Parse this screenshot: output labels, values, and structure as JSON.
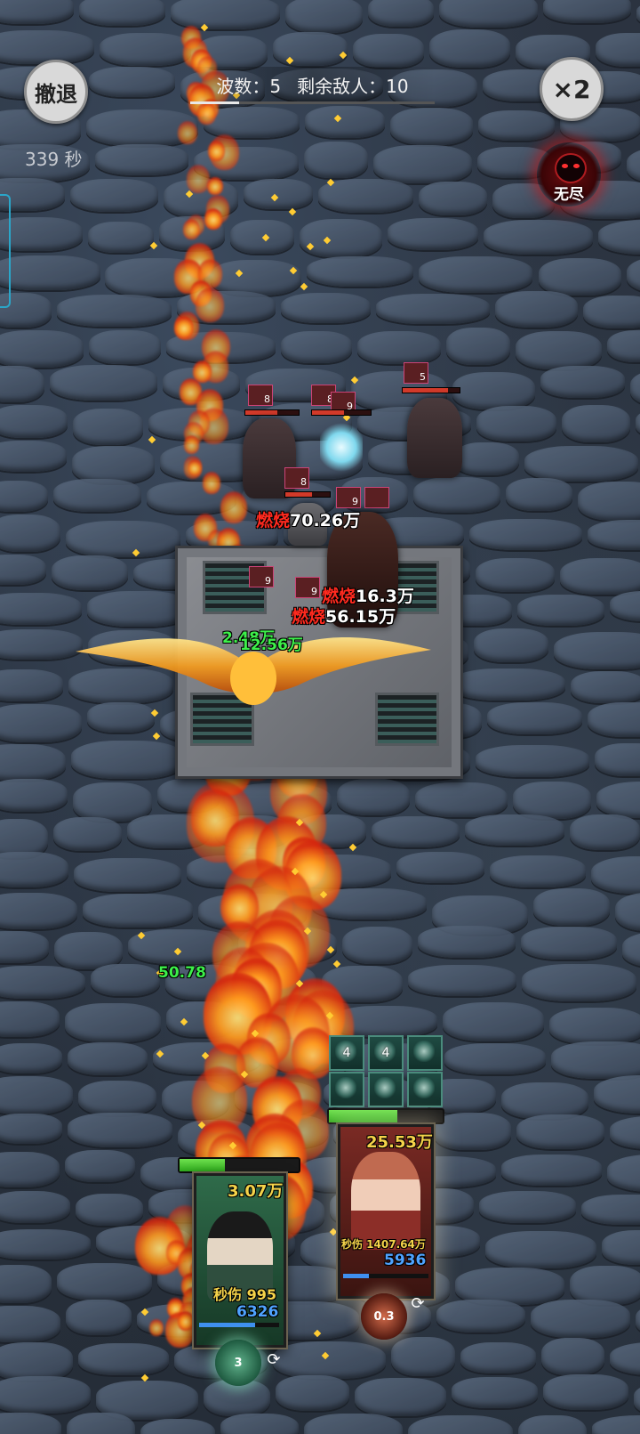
{
  "hud": {
    "retreat_label": "撤退",
    "timer": "339 秒",
    "wave_label": "波数：",
    "wave_value": "5",
    "enemies_label": "剩余敌人：",
    "enemies_value": "10",
    "wave_progress": 0.2,
    "speed_label": "×2",
    "endless_label": "无尽"
  },
  "enemies": [
    {
      "level": "8",
      "hp": 0.6
    },
    {
      "level": "8",
      "hp": 0.55
    },
    {
      "level": "9",
      "hp": 0.7
    },
    {
      "level": "5",
      "hp": 0.8
    },
    {
      "level": "8",
      "hp": 0.6
    },
    {
      "level": "9",
      "hp": 0.5
    },
    {
      "level": "9",
      "hp": 0.5
    },
    {
      "level": "9",
      "hp": 0.4
    }
  ],
  "damage_numbers": [
    {
      "tag": "燃烧",
      "value": "70.26万"
    },
    {
      "tag": "燃烧",
      "value": "16.3万"
    },
    {
      "tag": "燃烧",
      "value": "56.15万"
    },
    {
      "tag": "",
      "value": "2.48万"
    },
    {
      "tag": "",
      "value": "12.56万"
    },
    {
      "tag": "",
      "value": "50.78"
    }
  ],
  "skills": [
    {
      "icon": "bow-skill-icon",
      "count": "4"
    },
    {
      "icon": "wind-skill-icon",
      "count": "4"
    },
    {
      "icon": "dragon-skill-icon",
      "count": ""
    },
    {
      "icon": "figure-skill-icon",
      "count": ""
    },
    {
      "icon": "tree-skill-icon",
      "count": ""
    },
    {
      "icon": "spirit-skill-icon",
      "count": ""
    }
  ],
  "heroes": [
    {
      "name": "green-hero",
      "attack": "3.07万",
      "dps_label": "秒伤 995",
      "mana": "6326",
      "hp": 0.38,
      "mana_fill": 0.7,
      "ult_value": "3",
      "accent": "#2f6b4a"
    },
    {
      "name": "red-hero",
      "attack": "25.53万",
      "dps_label": "秒伤 1407.64万",
      "mana": "5936",
      "hp": 0.6,
      "mana_fill": 0.3,
      "ult_value": "0.3",
      "accent": "#7a2a24"
    }
  ],
  "colors": {
    "burn_tag": "#ff2a1f",
    "hero_hp": "#4bd336",
    "mana": "#3f90f0",
    "endless_glow": "#c81414"
  }
}
